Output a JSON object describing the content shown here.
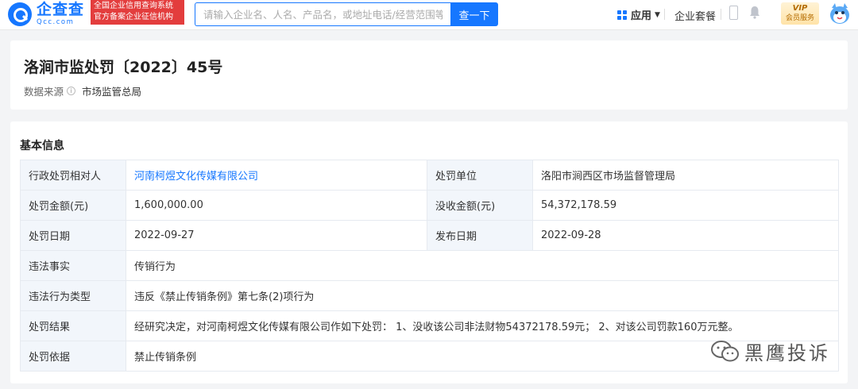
{
  "header": {
    "logo_cn": "企查查",
    "logo_en": "Qcc.com",
    "badge_line1": "全国企业信用查询系统",
    "badge_line2": "官方备案企业征信机构",
    "search_placeholder": "请输入企业名、人名、产品名，或地址电话/经营范围等",
    "search_button": "查一下",
    "nav_app": "应用",
    "nav_package": "企业套餐",
    "vip_top": "VIP",
    "vip_bottom": "会员服务"
  },
  "title_card": {
    "title": "洛涧市监处罚〔2022〕45号",
    "source_label": "数据来源",
    "source_value": "市场监管总局"
  },
  "basic_info": {
    "section_title": "基本信息",
    "rows": [
      {
        "k1": "行政处罚相对人",
        "v1": "河南柯煜文化传媒有限公司",
        "k2": "处罚单位",
        "v2": "洛阳市涧西区市场监督管理局"
      },
      {
        "k1": "处罚金额(元)",
        "v1": "1,600,000.00",
        "k2": "没收金额(元)",
        "v2": "54,372,178.59"
      },
      {
        "k1": "处罚日期",
        "v1": "2022-09-27",
        "k2": "发布日期",
        "v2": "2022-09-28"
      }
    ],
    "wide_rows": [
      {
        "k": "违法事实",
        "v": "传销行为"
      },
      {
        "k": "违法行为类型",
        "v": "违反《禁止传销条例》第七条(2)项行为"
      },
      {
        "k": "处罚结果",
        "v": "经研究决定，对河南柯煜文化传媒有限公司作如下处罚： 1、没收该公司非法财物54372178.59元； 2、对该公司罚款160万元整。"
      },
      {
        "k": "处罚依据",
        "v": "禁止传销条例"
      }
    ]
  },
  "watermark": {
    "text": "黑鹰投诉"
  },
  "colors": {
    "brand": "#1677ff",
    "badge": "#e33d3d",
    "key_cell_bg": "#f2f6fb"
  }
}
